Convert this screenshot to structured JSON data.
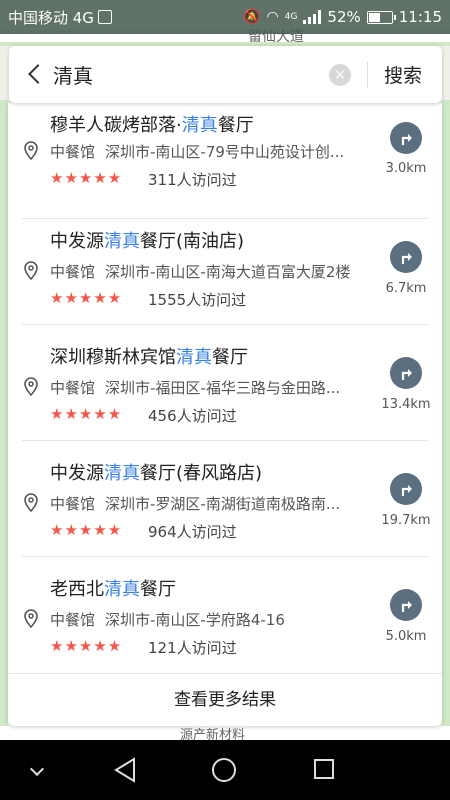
{
  "status_bar": {
    "carrier": "中国移动 4G",
    "network_small": "4G",
    "battery": "52%",
    "battery_level": 0.52,
    "time": "11:15"
  },
  "map": {
    "top_label": "留仙大道",
    "bottom_label": "源产新材料"
  },
  "search": {
    "query": "清真",
    "clear_glyph": "×",
    "button_label": "搜索"
  },
  "results": [
    {
      "name_before": "穆羊人碳烤部落·",
      "name_highlight": "清真",
      "name_after": "餐厅",
      "category": "中餐馆",
      "address": "深圳市-南山区-79号中山苑设计创...",
      "stars": "★★★★★",
      "visits": "311人访问过",
      "distance": "3.0km"
    },
    {
      "name_before": "中发源",
      "name_highlight": "清真",
      "name_after": "餐厅(南油店)",
      "category": "中餐馆",
      "address": "深圳市-南山区-南海大道百富大厦2楼",
      "stars": "★★★★★",
      "visits": "1555人访问过",
      "distance": "6.7km"
    },
    {
      "name_before": "深圳穆斯林宾馆",
      "name_highlight": "清真",
      "name_after": "餐厅",
      "category": "中餐馆",
      "address": "深圳市-福田区-福华三路与金田路...",
      "stars": "★★★★★",
      "visits": "456人访问过",
      "distance": "13.4km"
    },
    {
      "name_before": "中发源",
      "name_highlight": "清真",
      "name_after": "餐厅(春风路店)",
      "category": "中餐馆",
      "address": "深圳市-罗湖区-南湖街道南极路南...",
      "stars": "★★★★★",
      "visits": "964人访问过",
      "distance": "19.7km"
    },
    {
      "name_before": "老西北",
      "name_highlight": "清真",
      "name_after": "餐厅",
      "category": "中餐馆",
      "address": "深圳市-南山区-学府路4-16",
      "stars": "★★★★★",
      "visits": "121人访问过",
      "distance": "5.0km"
    }
  ],
  "more_results_label": "查看更多结果",
  "colors": {
    "highlight": "#3a82e6",
    "stars": "#f4574b",
    "route_button": "#5c6f80"
  }
}
